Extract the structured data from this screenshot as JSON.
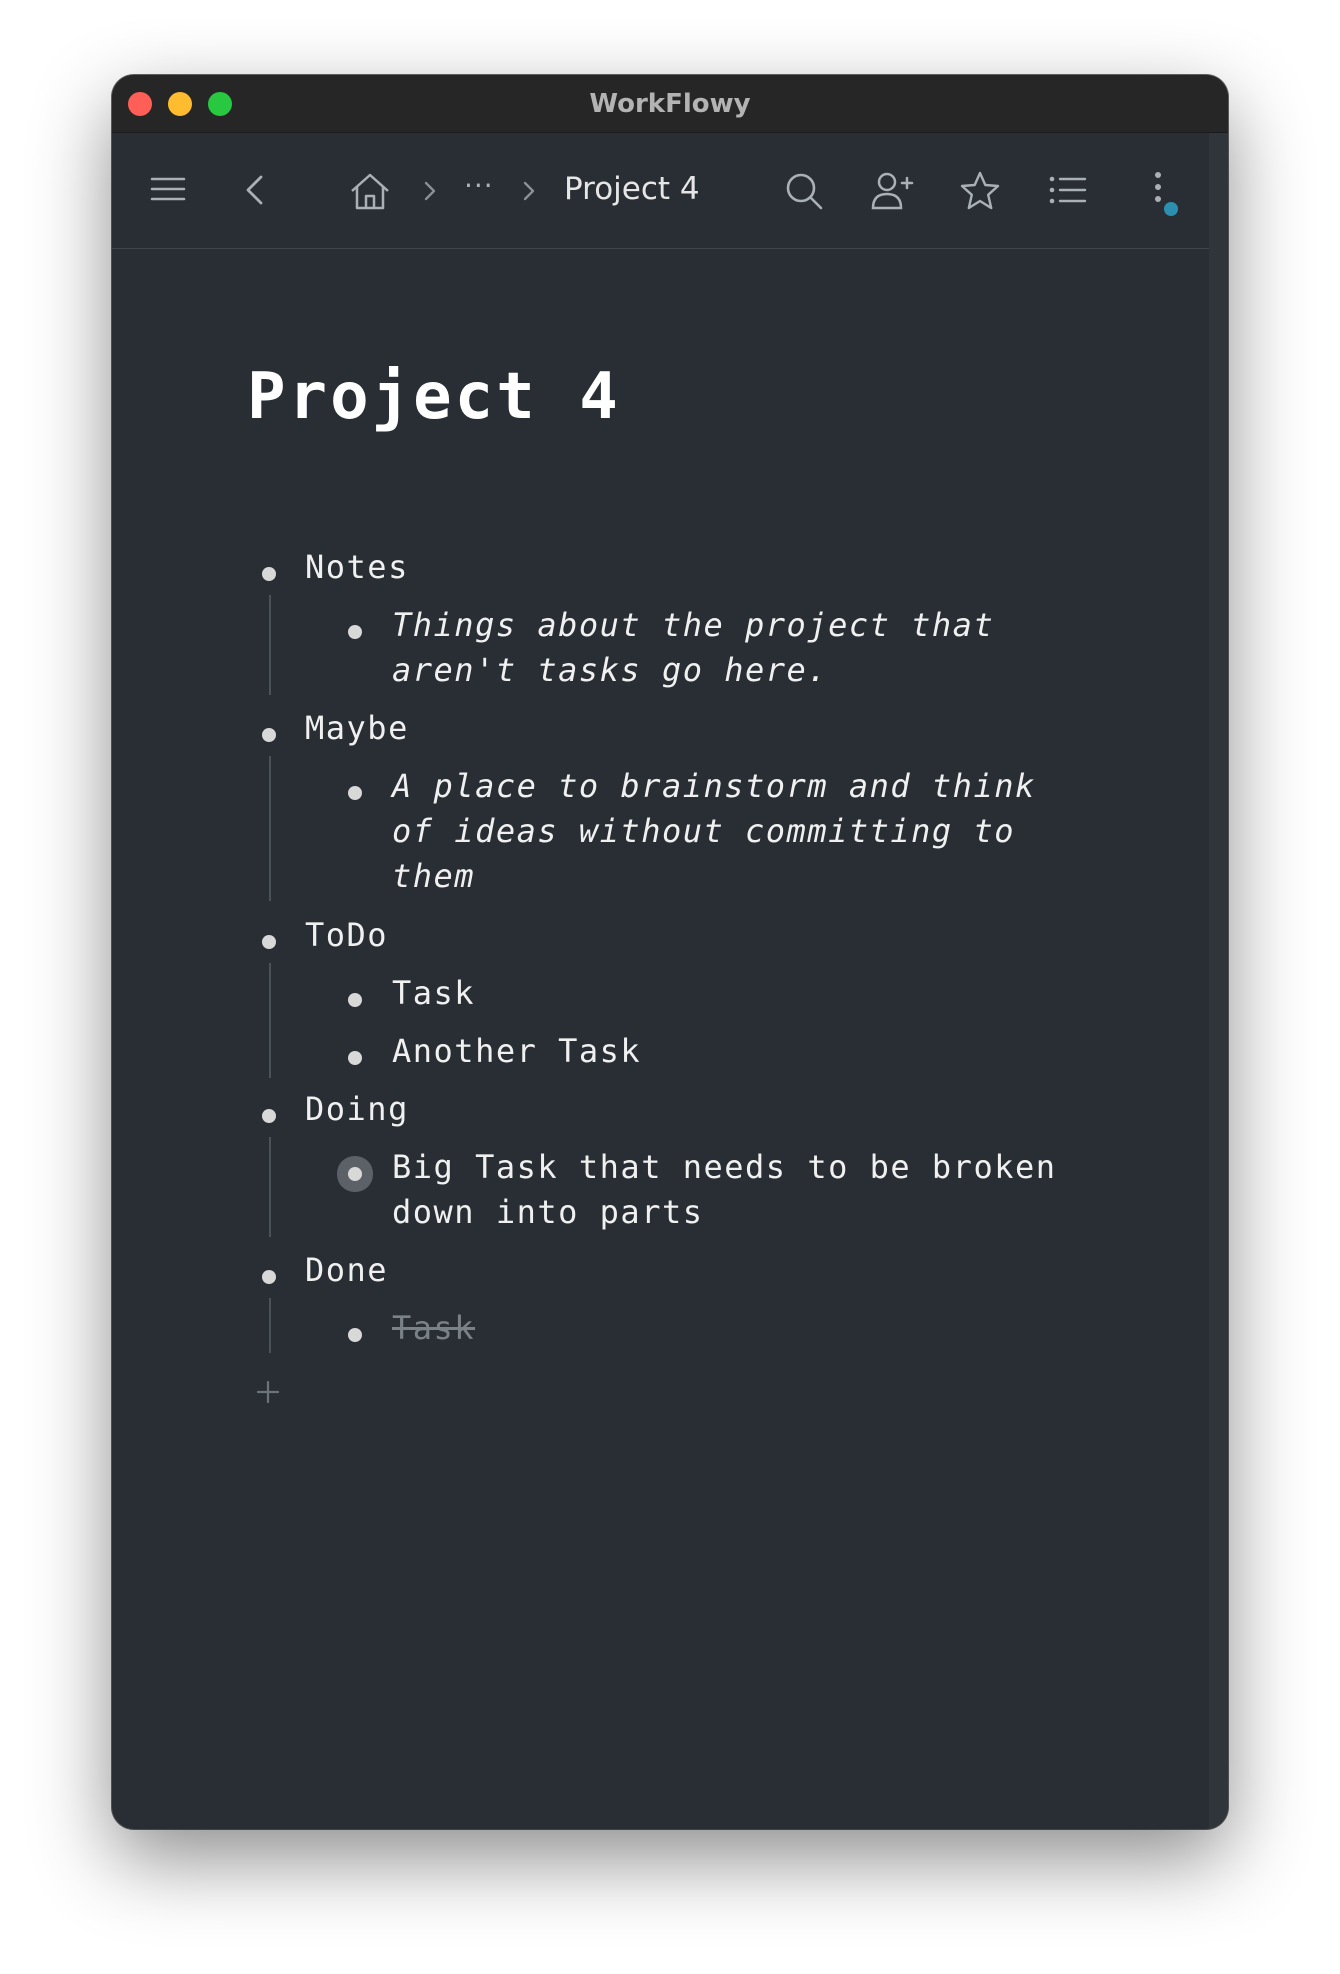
{
  "window": {
    "title": "WorkFlowy"
  },
  "toolbar": {
    "breadcrumb_ellipsis": "···",
    "current": "Project 4",
    "icons": [
      "menu-icon",
      "back-icon",
      "home-icon",
      "chevron-right-icon",
      "search-icon",
      "add-user-icon",
      "star-icon",
      "list-icon",
      "more-vertical-icon"
    ]
  },
  "page": {
    "title": "Project 4",
    "items": [
      {
        "label": "Notes",
        "children": [
          {
            "label": "Things about the project that\naren't tasks go here.",
            "style": "note"
          }
        ]
      },
      {
        "label": "Maybe",
        "children": [
          {
            "label": "A place to brainstorm and think\nof ideas without committing to\nthem",
            "style": "note"
          }
        ]
      },
      {
        "label": "ToDo",
        "children": [
          {
            "label": "Task"
          },
          {
            "label": "Another Task"
          }
        ]
      },
      {
        "label": "Doing",
        "children": [
          {
            "label": "Big Task that needs to be broken\ndown into parts",
            "collapsed": true
          }
        ]
      },
      {
        "label": "Done",
        "children": [
          {
            "label": "Task",
            "completed": true
          }
        ]
      }
    ]
  },
  "colors": {
    "background": "#282e33",
    "text": "#f0f0f0",
    "completed": "#7a8187",
    "accent": "#2d8fb0"
  }
}
